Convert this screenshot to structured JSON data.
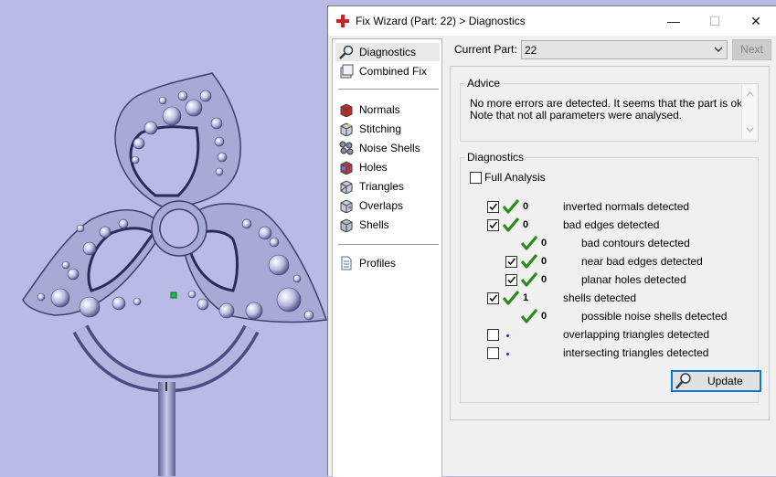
{
  "window": {
    "title": "Fix Wizard (Part: 22) > Diagnostics",
    "controls": {
      "minimize": "—",
      "maximize": "☐",
      "close": "✕"
    }
  },
  "nav": {
    "top": [
      {
        "label": "Diagnostics",
        "icon": "magnifier-icon",
        "selected": true
      },
      {
        "label": "Combined Fix",
        "icon": "combined-fix-icon"
      }
    ],
    "fixes": [
      {
        "label": "Normals",
        "icon": "normals-cube-icon"
      },
      {
        "label": "Stitching",
        "icon": "stitching-cube-icon"
      },
      {
        "label": "Noise Shells",
        "icon": "noise-shells-icon"
      },
      {
        "label": "Holes",
        "icon": "holes-cube-icon"
      },
      {
        "label": "Triangles",
        "icon": "triangles-cube-icon"
      },
      {
        "label": "Overlaps",
        "icon": "overlaps-cube-icon"
      },
      {
        "label": "Shells",
        "icon": "shells-cube-icon"
      }
    ],
    "bottom": [
      {
        "label": "Profiles",
        "icon": "profiles-page-icon"
      }
    ]
  },
  "header": {
    "current_part_label": "Current Part:",
    "current_part_value": "22",
    "next_label": "Next"
  },
  "advice": {
    "title": "Advice",
    "line1": "No more errors are detected. It seems that the part is ok.",
    "line2": "Note that not all parameters were analysed."
  },
  "diagnostics": {
    "title": "Diagnostics",
    "full_analysis_label": "Full Analysis",
    "full_analysis_checked": false,
    "rows": [
      {
        "label": "inverted normals detected",
        "count": "0",
        "checkbox": true,
        "checked": true,
        "status": "ok",
        "indent": 0
      },
      {
        "label": "bad edges detected",
        "count": "0",
        "checkbox": true,
        "checked": true,
        "status": "ok",
        "indent": 0
      },
      {
        "label": "bad contours detected",
        "count": "0",
        "checkbox": false,
        "checked": false,
        "status": "ok",
        "indent": 1
      },
      {
        "label": "near bad edges detected",
        "count": "0",
        "checkbox": true,
        "checked": true,
        "status": "ok",
        "indent": 1
      },
      {
        "label": "planar holes detected",
        "count": "0",
        "checkbox": true,
        "checked": true,
        "status": "ok",
        "indent": 1
      },
      {
        "label": "shells detected",
        "count": "1",
        "checkbox": true,
        "checked": true,
        "status": "ok",
        "indent": 0
      },
      {
        "label": "possible noise shells detected",
        "count": "0",
        "checkbox": false,
        "checked": false,
        "status": "ok",
        "indent": 1
      },
      {
        "label": "overlapping triangles detected",
        "count": "",
        "checkbox": true,
        "checked": false,
        "status": "pending",
        "indent": 0
      },
      {
        "label": "intersecting triangles detected",
        "count": "",
        "checkbox": true,
        "checked": false,
        "status": "pending",
        "indent": 0
      }
    ],
    "update_label": "Update"
  },
  "colors": {
    "viewport_bg": "#b9bbe6",
    "model": "#a7a9d6",
    "tick_green": "#2b8a1a",
    "accent_blue": "#0f78d7"
  }
}
